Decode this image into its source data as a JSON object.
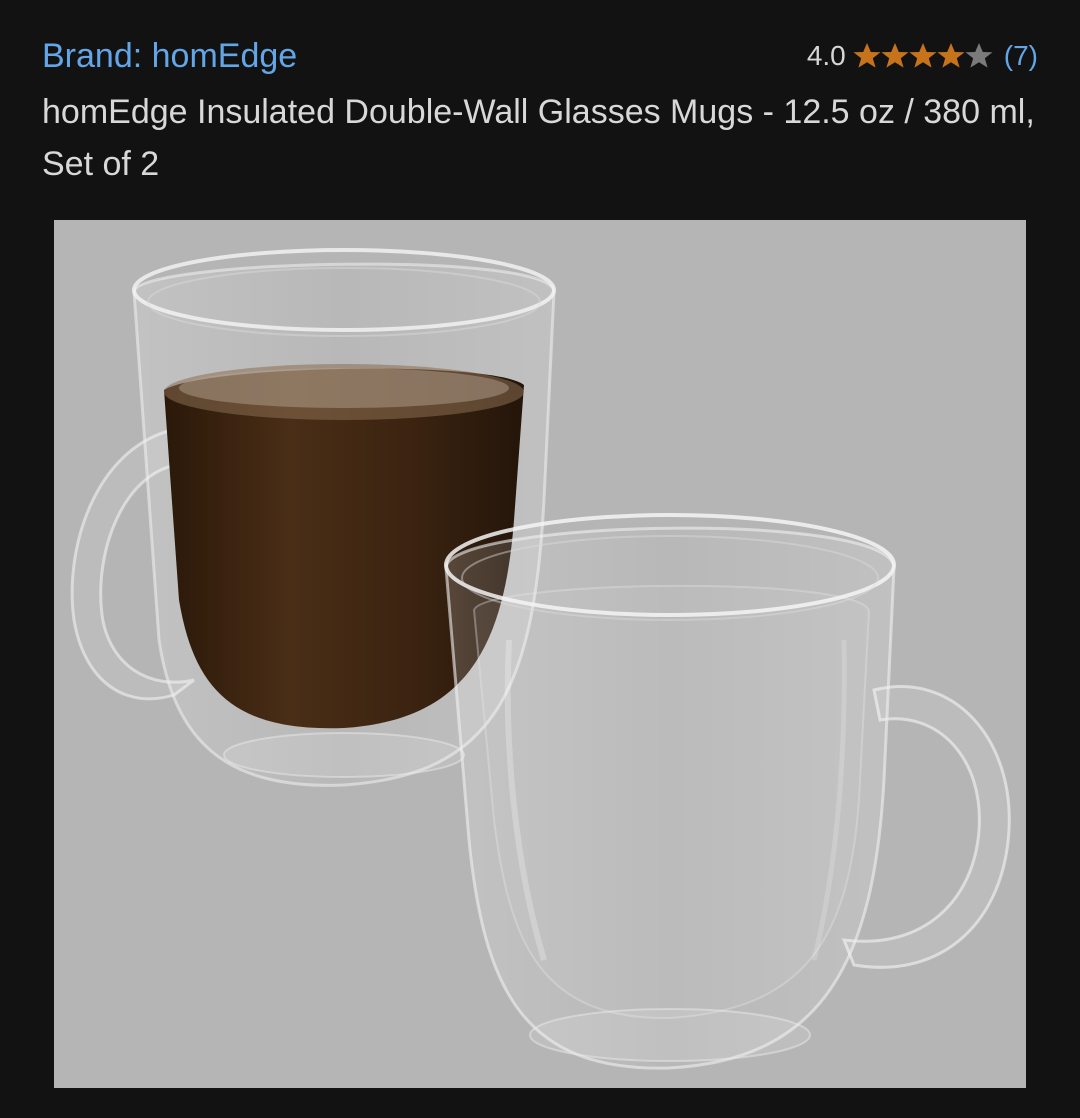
{
  "product": {
    "brand_label": "Brand: homEdge",
    "rating_value": "4.0",
    "rating_stars": 4,
    "rating_max": 5,
    "rating_count": "(7)",
    "title": "homEdge Insulated Double-Wall Glasses Mugs - 12.5 oz / 380 ml, Set of 2",
    "image_icon": "product-photo-two-glass-mugs"
  },
  "colors": {
    "background": "#121212",
    "link": "#62a6e8",
    "star_filled": "#c7731c",
    "star_empty": "#7a7a7a",
    "image_bg": "#b5b5b5",
    "coffee": "#3a2412"
  }
}
